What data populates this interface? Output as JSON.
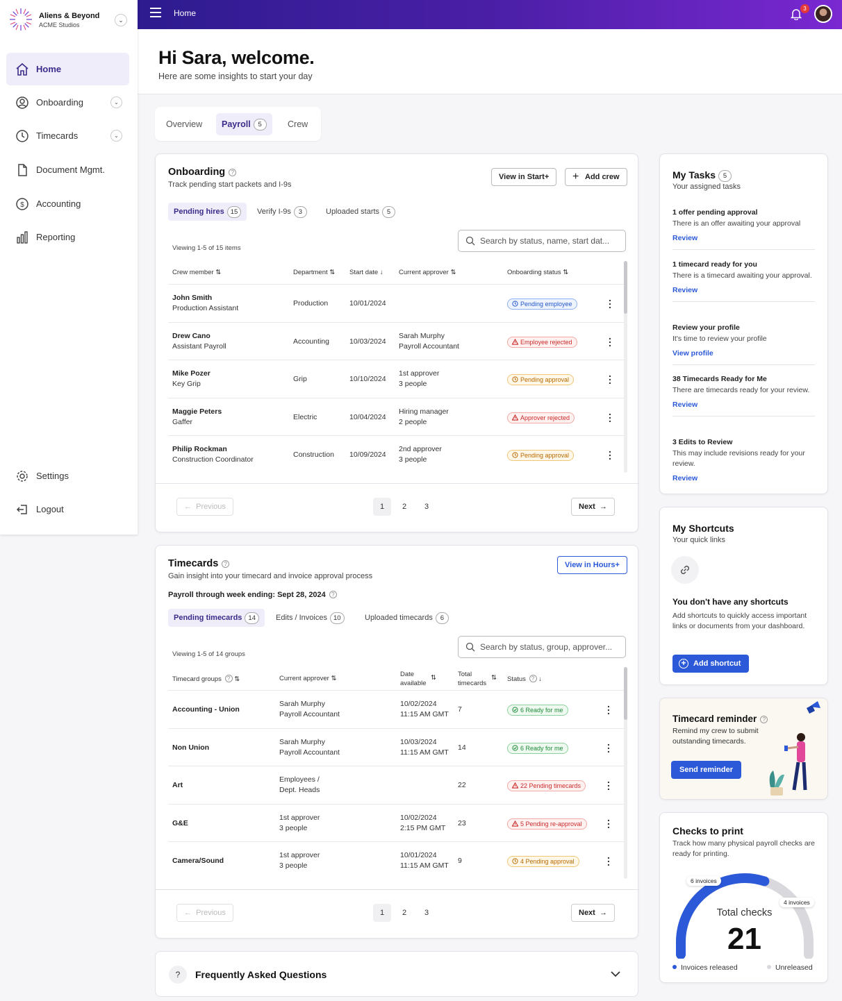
{
  "brand": {
    "name": "Aliens & Beyond",
    "sub": "ACME Studios"
  },
  "sidebar": {
    "items": [
      {
        "label": "Home"
      },
      {
        "label": "Onboarding"
      },
      {
        "label": "Timecards"
      },
      {
        "label": "Document Mgmt."
      },
      {
        "label": "Accounting"
      },
      {
        "label": "Reporting"
      }
    ],
    "bottom": [
      {
        "label": "Settings"
      },
      {
        "label": "Logout"
      }
    ]
  },
  "topbar": {
    "title": "Home",
    "notifications": "3"
  },
  "welcome": {
    "title": "Hi Sara, welcome.",
    "subtitle": "Here are some insights to start your day"
  },
  "tabs": [
    {
      "label": "Overview"
    },
    {
      "label": "Payroll",
      "count": "5"
    },
    {
      "label": "Crew"
    }
  ],
  "onboarding": {
    "title": "Onboarding",
    "subtitle": "Track pending start packets and I-9s",
    "view_btn": "View in Start+",
    "add_btn": "Add crew",
    "subtabs": [
      {
        "label": "Pending hires",
        "count": "15"
      },
      {
        "label": "Verify I-9s",
        "count": "3"
      },
      {
        "label": "Uploaded starts",
        "count": "5"
      }
    ],
    "search_placeholder": "Search by status, name, start dat...",
    "viewing": "Viewing 1-5 of 15 items",
    "columns": [
      "Crew member",
      "Department",
      "Start date",
      "Current approver",
      "Onboarding status"
    ],
    "rows": [
      {
        "name": "John Smith",
        "role": "Production Assistant",
        "dept": "Production",
        "date": "10/01/2024",
        "approver": "",
        "approver_sub": "",
        "status": "Pending employee",
        "color": "blue"
      },
      {
        "name": "Drew Cano",
        "role": "Assistant Payroll",
        "dept": "Accounting",
        "date": "10/03/2024",
        "approver": "Sarah Murphy",
        "approver_sub": "Payroll Accountant",
        "status": "Employee rejected",
        "color": "red"
      },
      {
        "name": "Mike Pozer",
        "role": "Key Grip",
        "dept": "Grip",
        "date": "10/10/2024",
        "approver": "1st approver",
        "approver_sub": "3 people",
        "status": "Pending approval",
        "color": "orange"
      },
      {
        "name": "Maggie Peters",
        "role": "Gaffer",
        "dept": "Electric",
        "date": "10/04/2024",
        "approver": "Hiring manager",
        "approver_sub": "2 people",
        "status": "Approver rejected",
        "color": "red"
      },
      {
        "name": "Philip Rockman",
        "role": "Construction Coordinator",
        "dept": "Construction",
        "date": "10/09/2024",
        "approver": "2nd approver",
        "approver_sub": "3 people",
        "status": "Pending approval",
        "color": "orange"
      }
    ],
    "pager": {
      "prev": "Previous",
      "next": "Next",
      "pages": [
        "1",
        "2",
        "3"
      ]
    }
  },
  "timecards": {
    "title": "Timecards",
    "subtitle": "Gain insight into your timecard and invoice approval process",
    "view_btn": "View in Hours+",
    "week": "Payroll through week ending: Sept 28, 2024",
    "subtabs": [
      {
        "label": "Pending timecards",
        "count": "14"
      },
      {
        "label": "Edits / Invoices",
        "count": "10"
      },
      {
        "label": "Uploaded timecards",
        "count": "6"
      }
    ],
    "search_placeholder": "Search by status, group, approver...",
    "viewing": "Viewing 1-5 of 14 groups",
    "columns": [
      "Timecard groups",
      "Current approver",
      "Date",
      "available",
      "Total",
      "timecards",
      "Status"
    ],
    "rows": [
      {
        "group": "Accounting - Union",
        "approver": "Sarah Murphy",
        "approver_sub": "Payroll Accountant",
        "date": "10/02/2024",
        "time": "11:15 AM GMT",
        "total": "7",
        "status": "6 Ready for me",
        "color": "green"
      },
      {
        "group": "Non Union",
        "approver": "Sarah Murphy",
        "approver_sub": "Payroll Accountant",
        "date": "10/03/2024",
        "time": "11:15 AM GMT",
        "total": "14",
        "status": "6 Ready for me",
        "color": "green"
      },
      {
        "group": "Art",
        "approver": "Employees /",
        "approver_sub": "Dept. Heads",
        "date": "",
        "time": "",
        "total": "22",
        "status": "22 Pending timecards",
        "color": "red"
      },
      {
        "group": "G&E",
        "approver": "1st approver",
        "approver_sub": "3 people",
        "date": "10/02/2024",
        "time": "2:15 PM GMT",
        "total": "23",
        "status": "5 Pending re-approval",
        "color": "red"
      },
      {
        "group": "Camera/Sound",
        "approver": "1st approver",
        "approver_sub": "3 people",
        "date": "10/01/2024",
        "time": "11:15 AM GMT",
        "total": "9",
        "status": "4 Pending approval",
        "color": "orange"
      }
    ],
    "pager": {
      "prev": "Previous",
      "next": "Next",
      "pages": [
        "1",
        "2",
        "3"
      ]
    }
  },
  "faq": {
    "title": "Frequently Asked Questions"
  },
  "tasks": {
    "title": "My Tasks",
    "count": "5",
    "subtitle": "Your assigned tasks",
    "items": [
      {
        "title": "1 offer pending approval",
        "desc": "There is an offer awaiting your approval",
        "link": "Review"
      },
      {
        "title": "1 timecard ready for you",
        "desc": "There is a timecard awaiting your approval.",
        "link": "Review"
      },
      {
        "title": "Review your profile",
        "desc": "It's time to review your profile",
        "link": "View profile"
      },
      {
        "title": "38 Timecards Ready for Me",
        "desc": "There are timecards ready for your review.",
        "link": "Review"
      },
      {
        "title": "3 Edits to Review",
        "desc": "This may include revisions ready for your review.",
        "link": "Review"
      }
    ]
  },
  "shortcuts": {
    "title": "My Shortcuts",
    "subtitle": "Your quick links",
    "empty_title": "You don't have any shortcuts",
    "empty_desc": "Add shortcuts to quickly access important links or documents from your dashboard.",
    "add_btn": "Add shortcut"
  },
  "reminder": {
    "title": "Timecard reminder",
    "desc": "Remind my crew to submit outstanding timecards.",
    "btn": "Send reminder"
  },
  "checks": {
    "title": "Checks to print",
    "desc": "Track how many physical payroll checks are ready for printing.",
    "label_left": "6 invoices",
    "label_right": "4 invoices",
    "total_label": "Total checks",
    "total": "21",
    "legend_released": "Invoices released",
    "legend_unreleased": "Unreleased",
    "released_fraction": 0.6
  }
}
